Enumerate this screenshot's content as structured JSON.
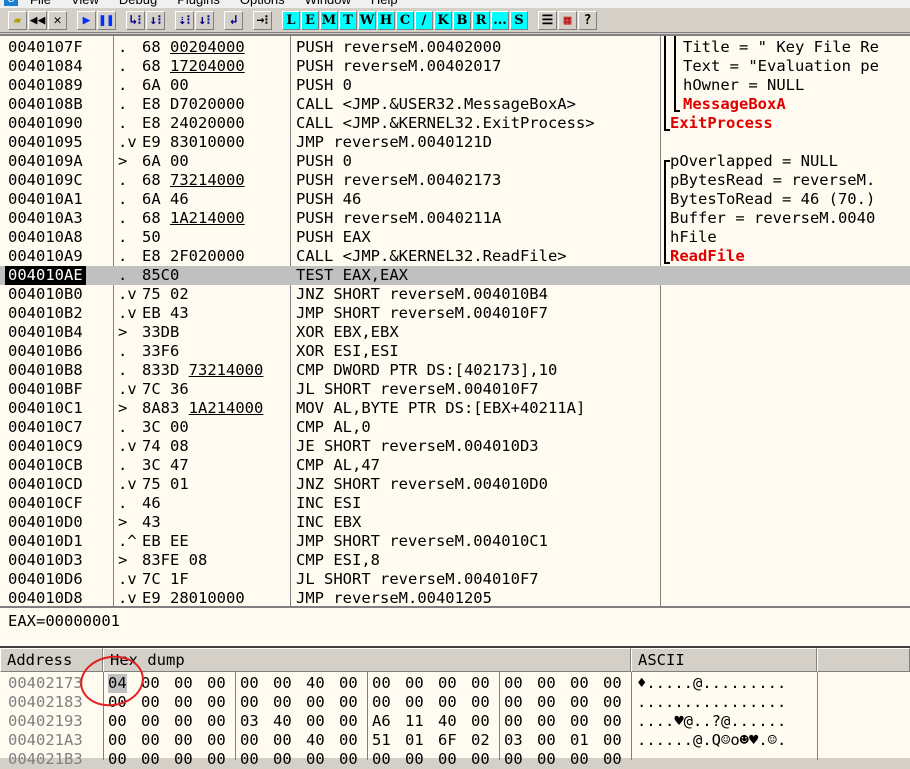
{
  "menu": [
    "File",
    "View",
    "Debug",
    "Plugins",
    "Options",
    "Window",
    "Help"
  ],
  "toolbar": {
    "left": [
      "open",
      "restart",
      "close",
      "run",
      "pause",
      "step-into",
      "step-over",
      "trace-into",
      "trace-over",
      "execute-till-return",
      "go-to"
    ],
    "letters": [
      "L",
      "E",
      "M",
      "T",
      "W",
      "H",
      "C",
      "/",
      "K",
      "B",
      "R",
      "...",
      "S"
    ]
  },
  "disasm": [
    {
      "addr": "0040107F",
      "mk": ".",
      "hex": "68 ",
      "hexu": "00204000",
      "asm": "PUSH reverseM.00402000",
      "cm": "Title = \" Key File Re"
    },
    {
      "addr": "00401084",
      "mk": ".",
      "hex": "68 ",
      "hexu": "17204000",
      "asm": "PUSH reverseM.00402017",
      "cm": "Text = \"Evaluation pe"
    },
    {
      "addr": "00401089",
      "mk": ".",
      "hex": "6A 00",
      "hexu": "",
      "asm": "PUSH 0",
      "cm": "hOwner = NULL"
    },
    {
      "addr": "0040108B",
      "mk": ".",
      "hex": "E8 D7020000",
      "hexu": "",
      "asm": "CALL <JMP.&USER32.MessageBoxA>",
      "cm": "MessageBoxA",
      "red": true
    },
    {
      "addr": "00401090",
      "mk": ".",
      "hex": "E8 24020000",
      "hexu": "",
      "asm": "CALL <JMP.&KERNEL32.ExitProcess>",
      "cm": "ExitProcess",
      "red": true,
      "in": true
    },
    {
      "addr": "00401095",
      "mk": ".v",
      "hex": "E9 83010000",
      "hexu": "",
      "asm": "JMP reverseM.0040121D",
      "cm": ""
    },
    {
      "addr": "0040109A",
      "mk": ">",
      "hex": "6A 00",
      "hexu": "",
      "asm": "PUSH 0",
      "cm": "pOverlapped = NULL",
      "in": true
    },
    {
      "addr": "0040109C",
      "mk": ".",
      "hex": "68 ",
      "hexu": "73214000",
      "asm": "PUSH reverseM.00402173",
      "cm": "pBytesRead = reverseM.",
      "in": true
    },
    {
      "addr": "004010A1",
      "mk": ".",
      "hex": "6A 46",
      "hexu": "",
      "asm": "PUSH 46",
      "cm": "BytesToRead = 46 (70.)",
      "in": true
    },
    {
      "addr": "004010A3",
      "mk": ".",
      "hex": "68 ",
      "hexu": "1A214000",
      "asm": "PUSH reverseM.0040211A",
      "cm": "Buffer = reverseM.0040",
      "in": true
    },
    {
      "addr": "004010A8",
      "mk": ".",
      "hex": "50",
      "hexu": "",
      "asm": "PUSH EAX",
      "cm": "hFile",
      "in": true
    },
    {
      "addr": "004010A9",
      "mk": ".",
      "hex": "E8 2F020000",
      "hexu": "",
      "asm": "CALL <JMP.&KERNEL32.ReadFile>",
      "cm": "ReadFile",
      "red": true,
      "in": true
    },
    {
      "addr": "004010AE",
      "mk": ".",
      "hex": "85C0",
      "hexu": "",
      "asm": "TEST EAX,EAX",
      "cm": "",
      "sel": true
    },
    {
      "addr": "004010B0",
      "mk": ".v",
      "hex": "75 02",
      "hexu": "",
      "asm": "JNZ SHORT reverseM.004010B4",
      "cm": ""
    },
    {
      "addr": "004010B2",
      "mk": ".v",
      "hex": "EB 43",
      "hexu": "",
      "asm": "JMP SHORT reverseM.004010F7",
      "cm": ""
    },
    {
      "addr": "004010B4",
      "mk": ">",
      "hex": "33DB",
      "hexu": "",
      "asm": "XOR EBX,EBX",
      "cm": ""
    },
    {
      "addr": "004010B6",
      "mk": ".",
      "hex": "33F6",
      "hexu": "",
      "asm": "XOR ESI,ESI",
      "cm": ""
    },
    {
      "addr": "004010B8",
      "mk": ".",
      "hex": "833D ",
      "hexu": "73214000",
      "asm": "CMP DWORD PTR DS:[402173],10",
      "cm": ""
    },
    {
      "addr": "004010BF",
      "mk": ".v",
      "hex": "7C 36",
      "hexu": "",
      "asm": "JL SHORT reverseM.004010F7",
      "cm": ""
    },
    {
      "addr": "004010C1",
      "mk": ">",
      "hex": "8A83 ",
      "hexu": "1A214000",
      "asm": "MOV AL,BYTE PTR DS:[EBX+40211A]",
      "cm": ""
    },
    {
      "addr": "004010C7",
      "mk": ".",
      "hex": "3C 00",
      "hexu": "",
      "asm": "CMP AL,0",
      "cm": ""
    },
    {
      "addr": "004010C9",
      "mk": ".v",
      "hex": "74 08",
      "hexu": "",
      "asm": "JE SHORT reverseM.004010D3",
      "cm": ""
    },
    {
      "addr": "004010CB",
      "mk": ".",
      "hex": "3C 47",
      "hexu": "",
      "asm": "CMP AL,47",
      "cm": ""
    },
    {
      "addr": "004010CD",
      "mk": ".v",
      "hex": "75 01",
      "hexu": "",
      "asm": "JNZ SHORT reverseM.004010D0",
      "cm": ""
    },
    {
      "addr": "004010CF",
      "mk": ".",
      "hex": "46",
      "hexu": "",
      "asm": "INC ESI",
      "cm": ""
    },
    {
      "addr": "004010D0",
      "mk": ">",
      "hex": "43",
      "hexu": "",
      "asm": "INC EBX",
      "cm": ""
    },
    {
      "addr": "004010D1",
      "mk": ".^",
      "hex": "EB EE",
      "hexu": "",
      "asm": "JMP SHORT reverseM.004010C1",
      "cm": ""
    },
    {
      "addr": "004010D3",
      "mk": ">",
      "hex": "83FE 08",
      "hexu": "",
      "asm": "CMP ESI,8",
      "cm": ""
    },
    {
      "addr": "004010D6",
      "mk": ".v",
      "hex": "7C 1F",
      "hexu": "",
      "asm": "JL SHORT reverseM.004010F7",
      "cm": ""
    },
    {
      "addr": "004010D8",
      "mk": ".v",
      "hex": "E9 28010000",
      "hexu": "",
      "asm": "JMP reverseM.00401205",
      "cm": ""
    }
  ],
  "info": "EAX=00000001",
  "dump": {
    "headers": {
      "address": "Address",
      "hex": "Hex dump",
      "ascii": "ASCII"
    },
    "rows": [
      {
        "addr": "00402173",
        "bytes": [
          "04",
          "00",
          "00",
          "00",
          "00",
          "00",
          "40",
          "00",
          "00",
          "00",
          "00",
          "00",
          "00",
          "00",
          "00",
          "00"
        ],
        "ascii": "♦.....@........."
      },
      {
        "addr": "00402183",
        "bytes": [
          "00",
          "00",
          "00",
          "00",
          "00",
          "00",
          "00",
          "00",
          "00",
          "00",
          "00",
          "00",
          "00",
          "00",
          "00",
          "00"
        ],
        "ascii": "................"
      },
      {
        "addr": "00402193",
        "bytes": [
          "00",
          "00",
          "00",
          "00",
          "03",
          "40",
          "00",
          "00",
          "A6",
          "11",
          "40",
          "00",
          "00",
          "00",
          "00",
          "00"
        ],
        "ascii": "....♥@..?@......"
      },
      {
        "addr": "004021A3",
        "bytes": [
          "00",
          "00",
          "00",
          "00",
          "00",
          "00",
          "40",
          "00",
          "51",
          "01",
          "6F",
          "02",
          "03",
          "00",
          "01",
          "00"
        ],
        "ascii": "......@.Q☺o☻♥.☺."
      },
      {
        "addr": "004021B3",
        "bytes": [
          "00",
          "00",
          "00",
          "00",
          "00",
          "00",
          "00",
          "00",
          "00",
          "00",
          "00",
          "00",
          "00",
          "00",
          "00",
          "00"
        ],
        "ascii": ""
      }
    ]
  },
  "colors": {
    "accent": "#00ffff",
    "api": "#e00000",
    "background": "#fffbf0"
  }
}
